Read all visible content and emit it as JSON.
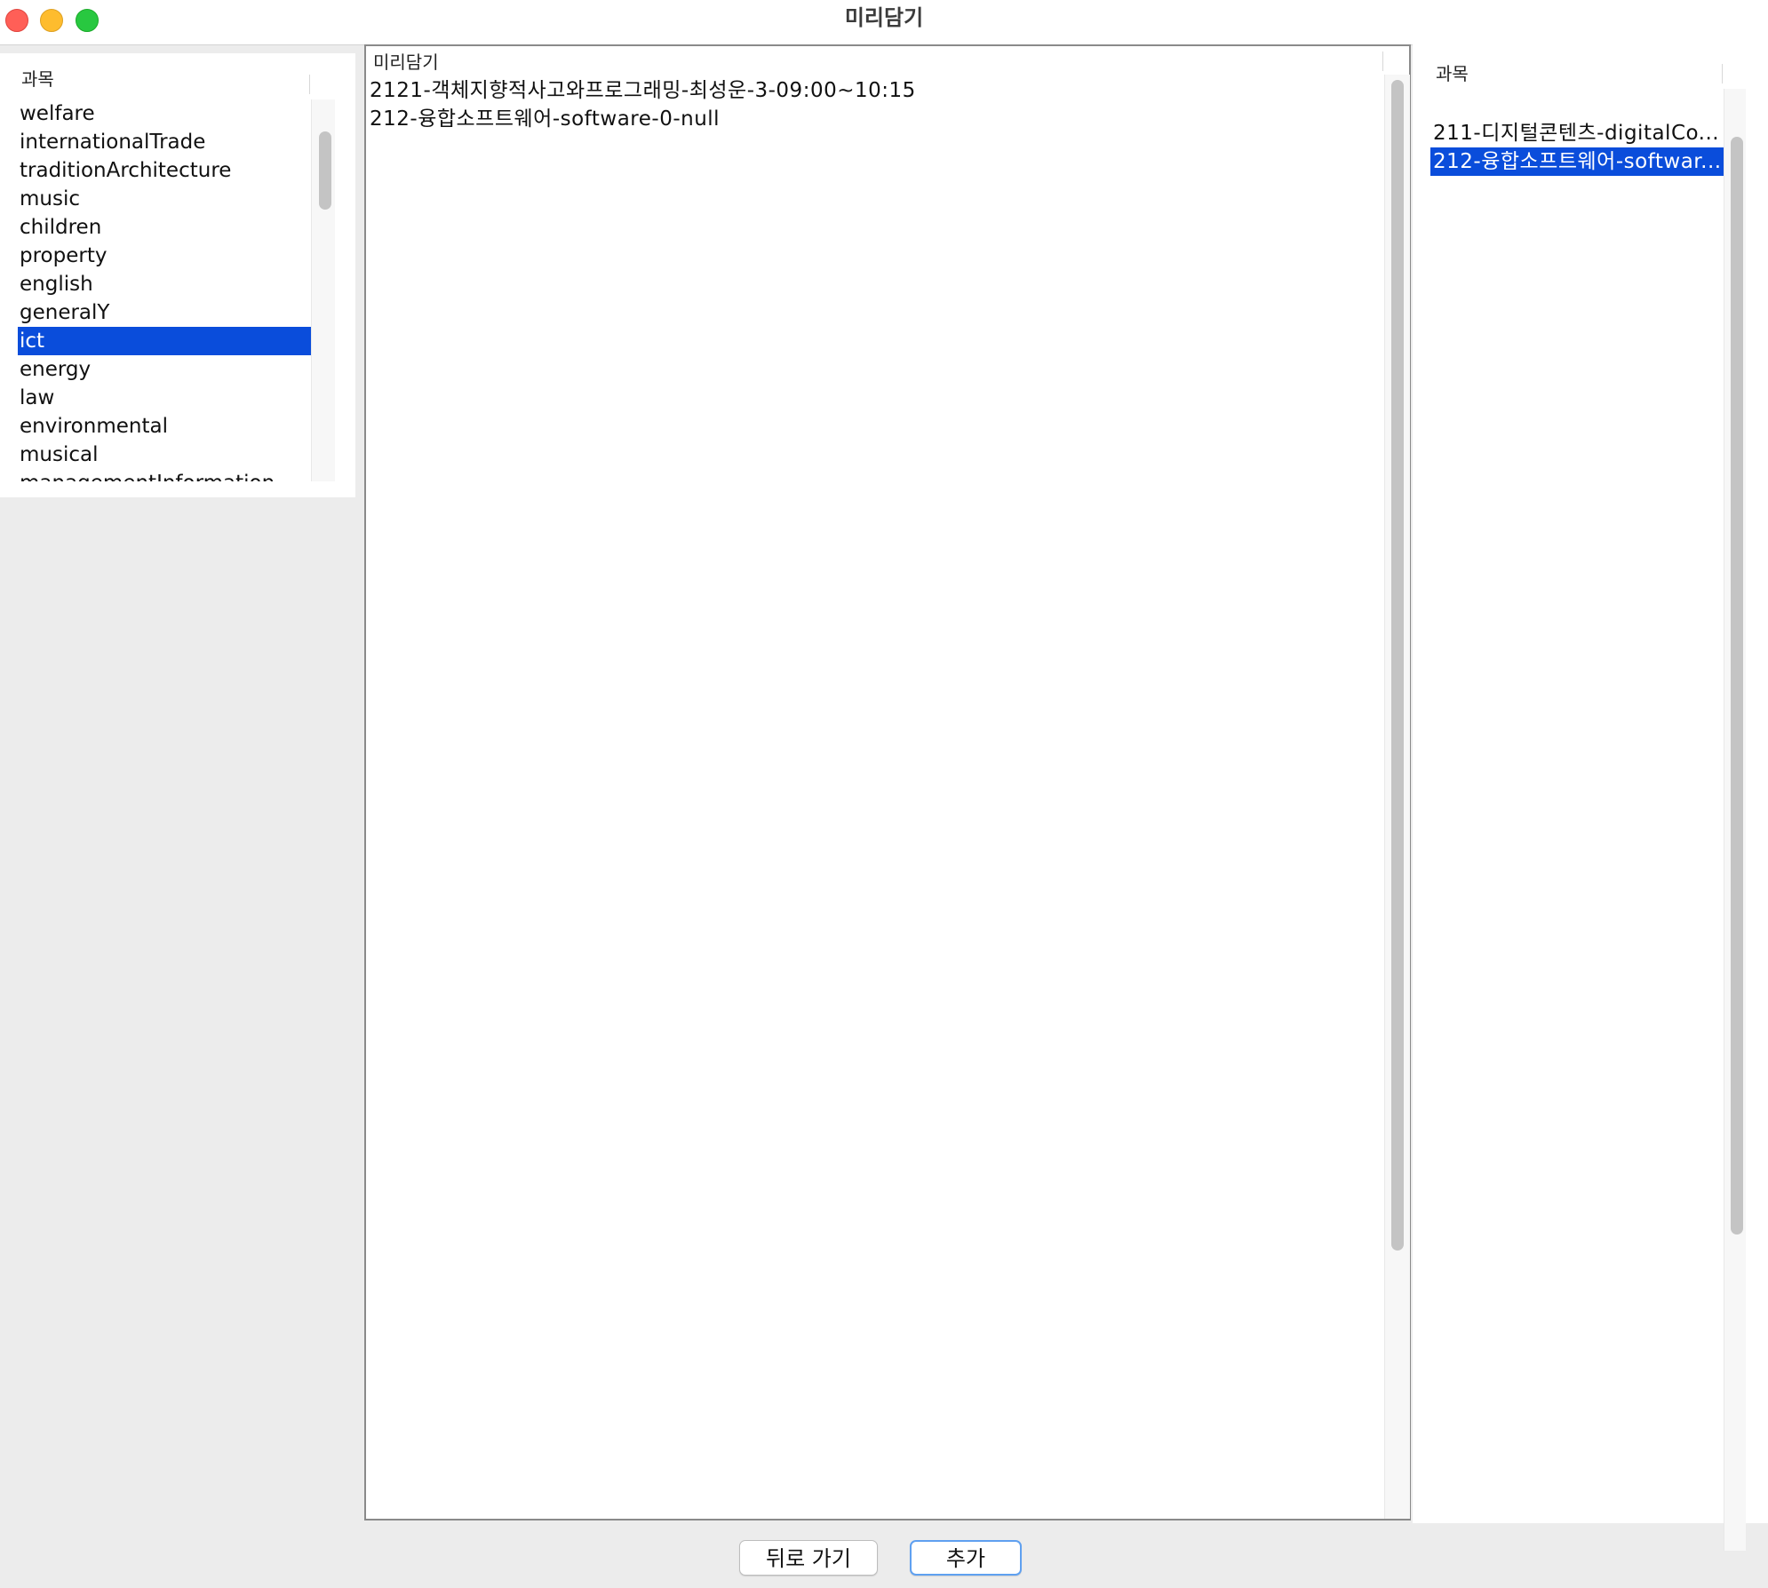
{
  "window": {
    "title": "미리담기"
  },
  "left": {
    "header": "과목",
    "items": [
      "welfare",
      "internationalTrade",
      "traditionArchitecture",
      "music",
      "children",
      "property",
      "english",
      "generalY",
      "ict",
      "energy",
      "law",
      "environmental",
      "musical",
      "managementInformation"
    ],
    "selected": "ict"
  },
  "center": {
    "header": "미리담기",
    "lines": [
      "2121-객체지향적사고와프로그래밍-최성운-3-09:00~10:15",
      "212-융합소프트웨어-software-0-null"
    ]
  },
  "right": {
    "header": "과목",
    "items": [
      "211-디지털콘텐츠-digitalCo...",
      "212-융합소프트웨어-softwar..."
    ],
    "selected": "212-융합소프트웨어-softwar..."
  },
  "buttons": {
    "back_label": "뒤로 가기",
    "add_label": "추가"
  },
  "colors": {
    "selection": "#0a4ddb",
    "focus_ring": "#5fa0f0"
  }
}
